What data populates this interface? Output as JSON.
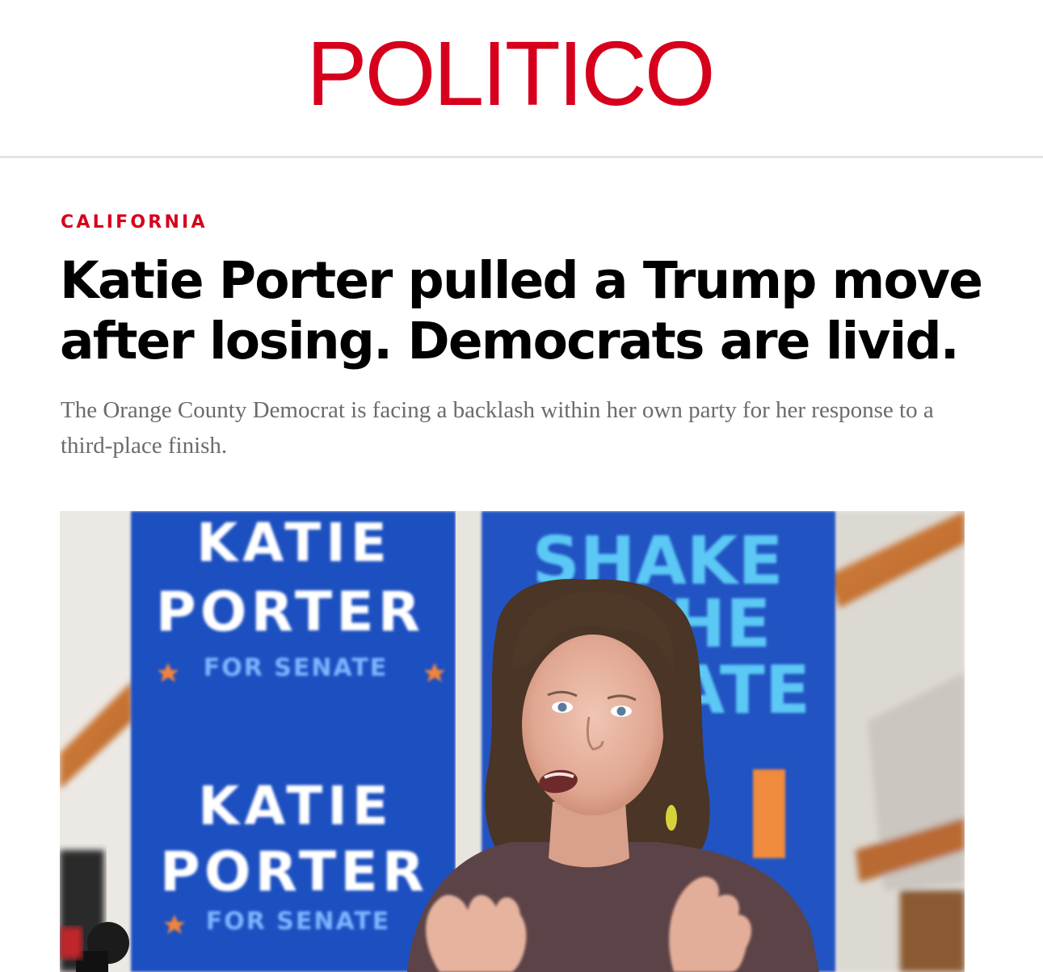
{
  "site": {
    "logo_text": "POLITICO",
    "brand_color": "#d6001c"
  },
  "article": {
    "section": "CALIFORNIA",
    "headline": "Katie Porter pulled a Trump move after losing. Democrats are livid.",
    "dek": "The Orange County Democrat is facing a backlash within her own party for her response to a third-place finish."
  },
  "photo": {
    "sign_left": {
      "line1": "KATIE",
      "line2": "PORTER",
      "line3": "FOR SENATE"
    },
    "sign_left_lower": {
      "line1": "KATIE",
      "line2": "PORTER",
      "line3": "FOR SENATE"
    },
    "sign_right": {
      "line1": "SHAKE",
      "line2": "THE",
      "line3": "STATE"
    },
    "colors": {
      "sign_blue": "#1f4fc0",
      "sign_text": "#ffffff",
      "sign_light_blue": "#5bc8f5",
      "star": "#f0843c"
    }
  }
}
